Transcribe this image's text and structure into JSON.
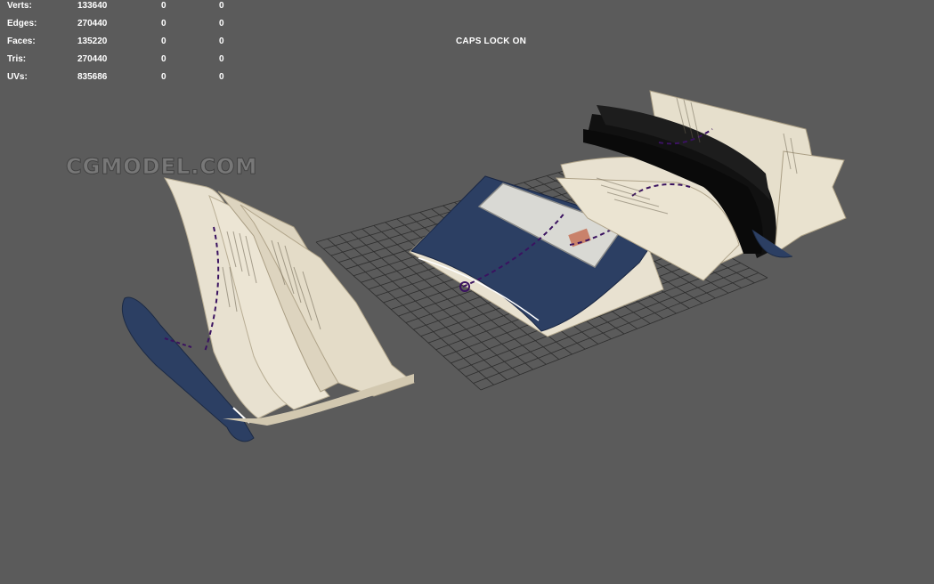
{
  "stats": {
    "rows": [
      {
        "label": "Verts:",
        "total": "133640",
        "sel1": "0",
        "sel2": "0"
      },
      {
        "label": "Edges:",
        "total": "270440",
        "sel1": "0",
        "sel2": "0"
      },
      {
        "label": "Faces:",
        "total": "135220",
        "sel1": "0",
        "sel2": "0"
      },
      {
        "label": "Tris:",
        "total": "270440",
        "sel1": "0",
        "sel2": "0"
      },
      {
        "label": "UVs:",
        "total": "835686",
        "sel1": "0",
        "sel2": "0"
      }
    ]
  },
  "status": {
    "caps_lock": "CAPS LOCK ON"
  },
  "watermark": {
    "text": "CGMODEL.COM"
  },
  "colors": {
    "viewport_bg": "#5b5b5b",
    "grid_line": "#2e2e2e",
    "cover_blue": "#2c3f63",
    "page_paper": "#e8e1d0",
    "curve_purple": "#3a1260"
  }
}
